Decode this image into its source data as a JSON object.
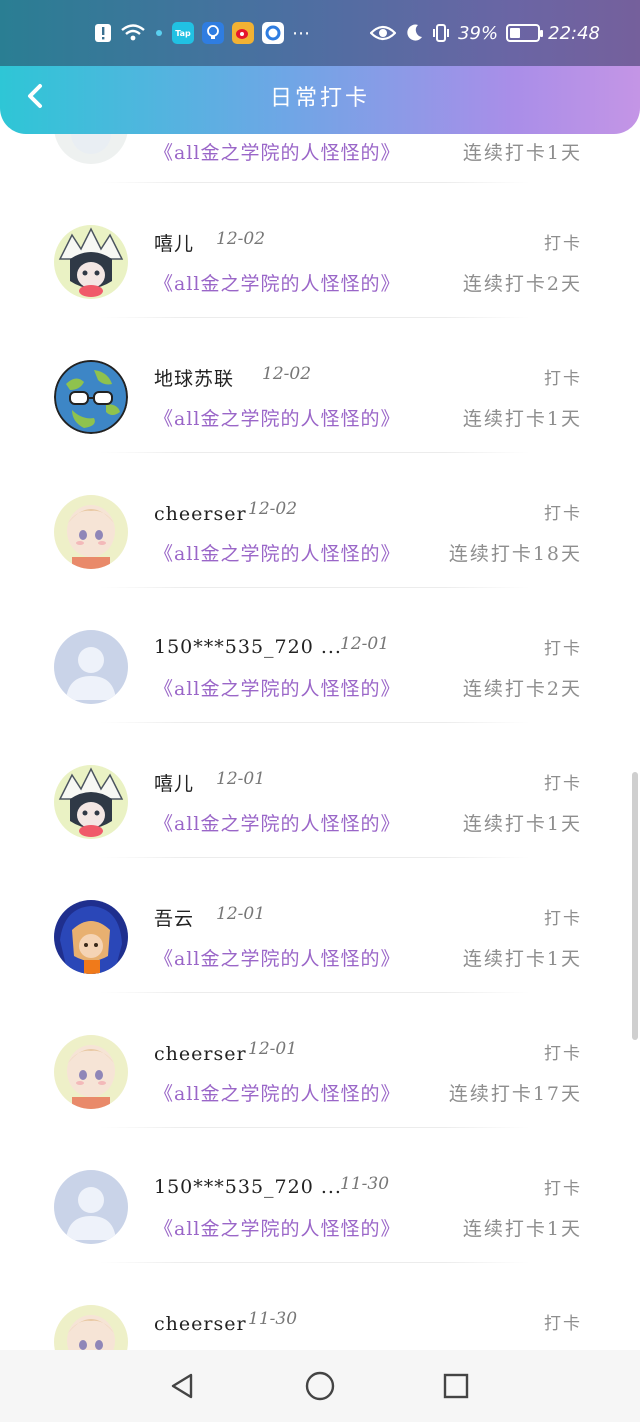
{
  "status_bar": {
    "battery_percent_text": "39%",
    "time": "22:48",
    "battery_level": 0.39,
    "notification_icons": [
      "alert-icon",
      "wifi-icon",
      "small-dot-icon",
      "taptap-app-icon",
      "bulb-app-icon",
      "weibo-app-icon",
      "browser-app-icon",
      "more-dots-icon"
    ],
    "taptap_label": "Tap"
  },
  "header": {
    "title": "日常打卡",
    "back_icon": "chevron-left-icon"
  },
  "list": {
    "items": [
      {
        "username": "",
        "date": "",
        "action": "",
        "book": "《all金之学院的人怪怪的》",
        "streak": "连续打卡1天",
        "avatar": "anime-white-hair"
      },
      {
        "username": "嘻儿",
        "date": "12-02",
        "action": "打卡",
        "book": "《all金之学院的人怪怪的》",
        "streak": "连续打卡2天",
        "avatar": "anime-white-hair"
      },
      {
        "username": "地球苏联",
        "date": "12-02",
        "action": "打卡",
        "book": "《all金之学院的人怪怪的》",
        "streak": "连续打卡1天",
        "avatar": "earth-ball"
      },
      {
        "username": "cheerser",
        "date": "12-02",
        "action": "打卡",
        "book": "《all金之学院的人怪怪的》",
        "streak": "连续打卡18天",
        "avatar": "baby"
      },
      {
        "username": "150***535_720 ...",
        "date": "12-01",
        "action": "打卡",
        "book": "《all金之学院的人怪怪的》",
        "streak": "连续打卡2天",
        "avatar": "default"
      },
      {
        "username": "嘻儿",
        "date": "12-01",
        "action": "打卡",
        "book": "《all金之学院的人怪怪的》",
        "streak": "连续打卡1天",
        "avatar": "anime-white-hair"
      },
      {
        "username": "吾云",
        "date": "12-01",
        "action": "打卡",
        "book": "《all金之学院的人怪怪的》",
        "streak": "连续打卡1天",
        "avatar": "anime-blue-hood"
      },
      {
        "username": "cheerser",
        "date": "12-01",
        "action": "打卡",
        "book": "《all金之学院的人怪怪的》",
        "streak": "连续打卡17天",
        "avatar": "baby"
      },
      {
        "username": "150***535_720 ...",
        "date": "11-30",
        "action": "打卡",
        "book": "《all金之学院的人怪怪的》",
        "streak": "连续打卡1天",
        "avatar": "default"
      },
      {
        "username": "cheerser",
        "date": "11-30",
        "action": "打卡",
        "book": "",
        "streak": "",
        "avatar": "baby"
      }
    ]
  },
  "navbar": {
    "back_icon": "triangle-back-icon",
    "home_icon": "circle-home-icon",
    "recents_icon": "square-recents-icon"
  },
  "colors": {
    "header_gradient_start": "#2ec6d6",
    "header_gradient_end": "#c495e6",
    "book_title": "#9a66c8",
    "meta_text": "#8e8e8e"
  }
}
